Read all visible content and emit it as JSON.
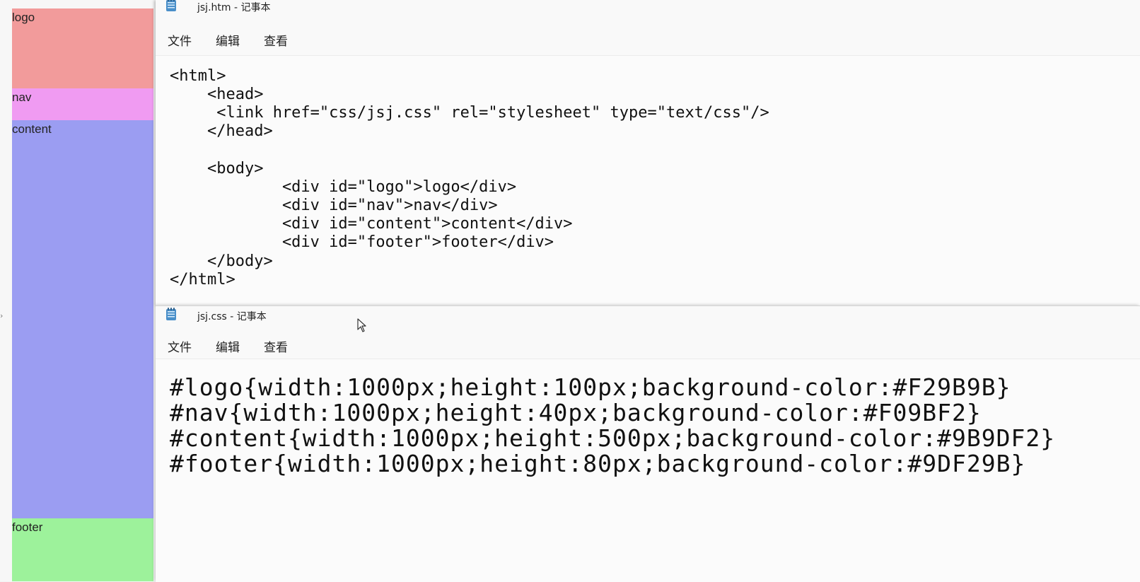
{
  "preview": {
    "blocks": [
      {
        "id": "logo",
        "label": "logo",
        "color": "#F29B9B"
      },
      {
        "id": "nav",
        "label": "nav",
        "color": "#F09BF2"
      },
      {
        "id": "content",
        "label": "content",
        "color": "#9B9DF2"
      },
      {
        "id": "footer",
        "label": "footer",
        "color": "#9DF29B"
      }
    ],
    "scroll_caret": "›"
  },
  "htm_window": {
    "title": "jsj.htm - 记事本",
    "icon": "notepad-icon",
    "menu": {
      "file": "文件",
      "edit": "编辑",
      "view": "查看"
    },
    "lines": [
      "<html>",
      "    <head>",
      "     <link href=\"css/jsj.css\" rel=\"stylesheet\" type=\"text/css\"/>",
      "    </head>",
      "",
      "    <body>",
      "            <div id=\"logo\">logo</div>",
      "            <div id=\"nav\">nav</div>",
      "            <div id=\"content\">content</div>",
      "            <div id=\"footer\">footer</div>",
      "    </body>",
      "</html>"
    ]
  },
  "css_window": {
    "title": "jsj.css - 记事本",
    "icon": "notepad-icon",
    "menu": {
      "file": "文件",
      "edit": "编辑",
      "view": "查看"
    },
    "lines": [
      "#logo{width:1000px;height:100px;background-color:#F29B9B}",
      "#nav{width:1000px;height:40px;background-color:#F09BF2}",
      "#content{width:1000px;height:500px;background-color:#9B9DF2}",
      "#footer{width:1000px;height:80px;background-color:#9DF29B}"
    ]
  },
  "colors": {
    "window_bg": "#f9f9f9",
    "text": "#111111"
  }
}
